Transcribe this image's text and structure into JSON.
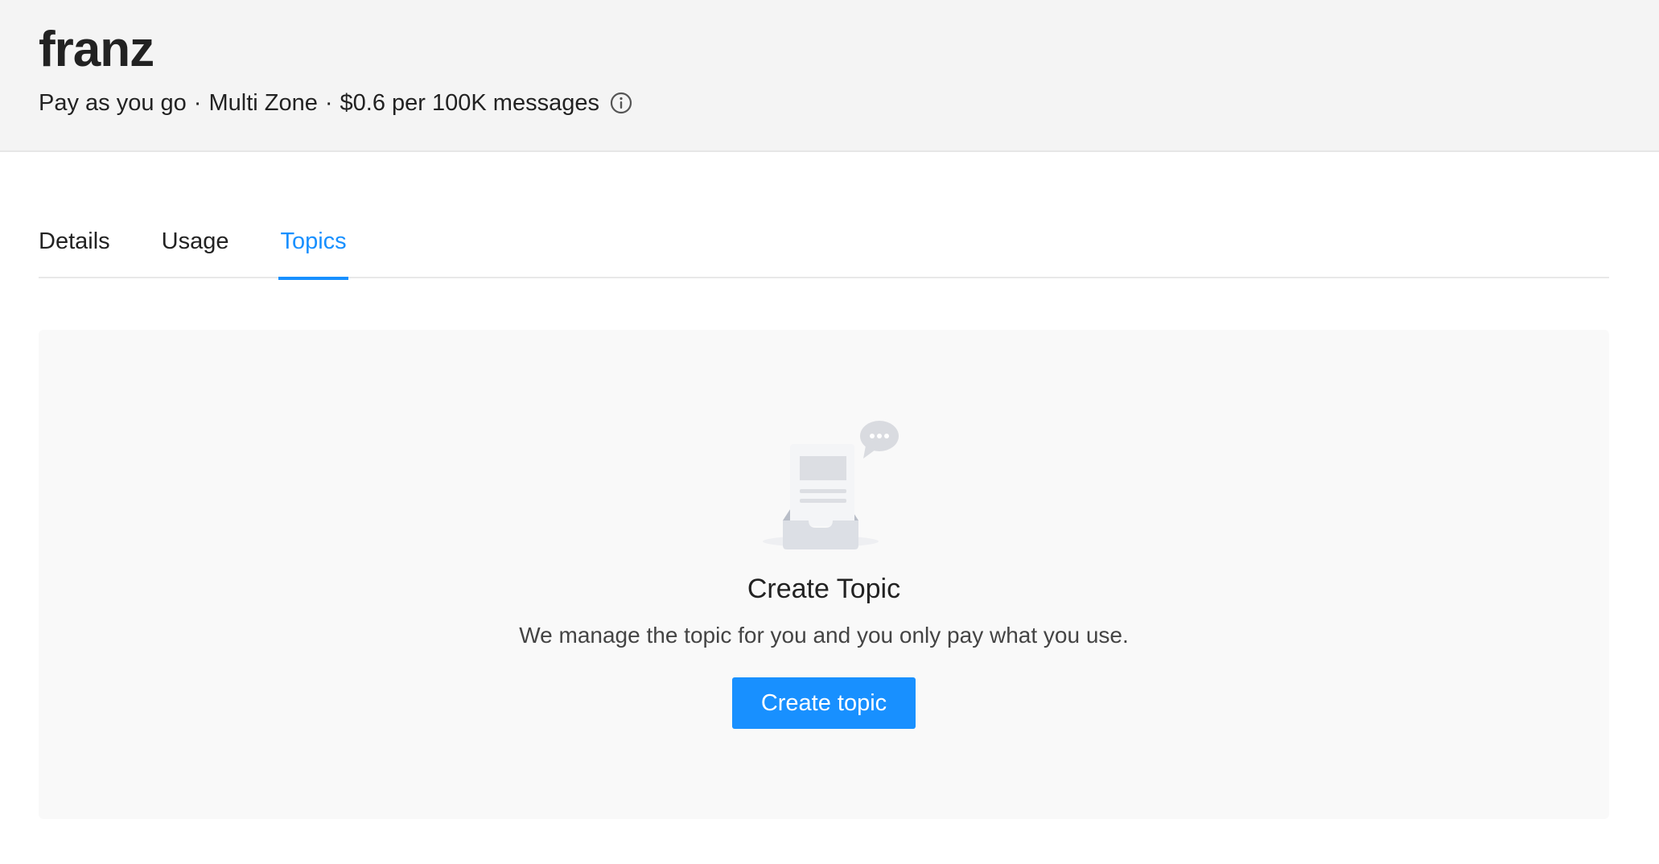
{
  "header": {
    "cluster_name": "franz",
    "plan": {
      "billing": "Pay as you go",
      "separator": "·",
      "zone": "Multi Zone",
      "price": "$0.6 per 100K messages"
    },
    "info_icon": "info-circle-icon"
  },
  "tabs": [
    {
      "label": "Details",
      "active": false
    },
    {
      "label": "Usage",
      "active": false
    },
    {
      "label": "Topics",
      "active": true
    }
  ],
  "empty_state": {
    "illustration": "empty-inbox-icon",
    "title": "Create Topic",
    "description": "We manage the topic for you and you only pay what you use.",
    "button_label": "Create topic"
  },
  "colors": {
    "accent": "#1890ff",
    "header_bg": "#f4f4f4",
    "card_bg": "#f9f9f9"
  }
}
